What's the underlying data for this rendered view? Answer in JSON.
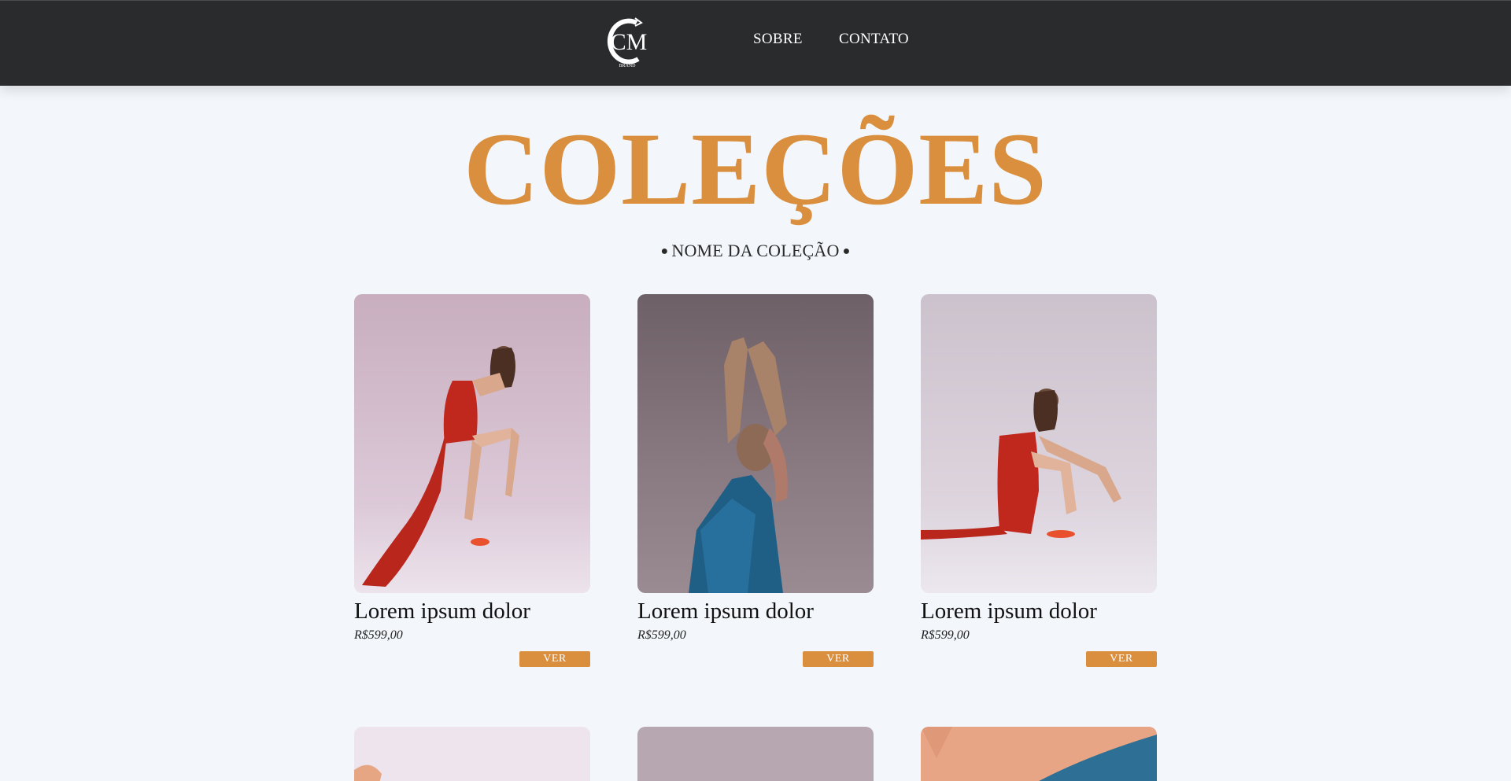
{
  "header": {
    "logo_text": "CM",
    "logo_subtext": "BRAND",
    "nav": [
      {
        "label": "SOBRE"
      },
      {
        "label": "CONTATO"
      }
    ]
  },
  "main": {
    "title": "COLEÇÕES",
    "collection_name": "NOME DA COLEÇÃO",
    "products": [
      {
        "name": "Lorem ipsum dolor",
        "price": "R$599,00",
        "button": "VER",
        "dress_color": "red",
        "bg_color": "#d9c6d3"
      },
      {
        "name": "Lorem ipsum dolor",
        "price": "R$599,00",
        "button": "VER",
        "dress_color": "blue",
        "bg_color": "#8a7a80"
      },
      {
        "name": "Lorem ipsum dolor",
        "price": "R$599,00",
        "button": "VER",
        "dress_color": "red",
        "bg_color": "#ddd3dd"
      }
    ]
  },
  "colors": {
    "accent": "#d98f3d",
    "header_bg": "#2a2b2d",
    "page_bg": "#f3f7fb"
  }
}
